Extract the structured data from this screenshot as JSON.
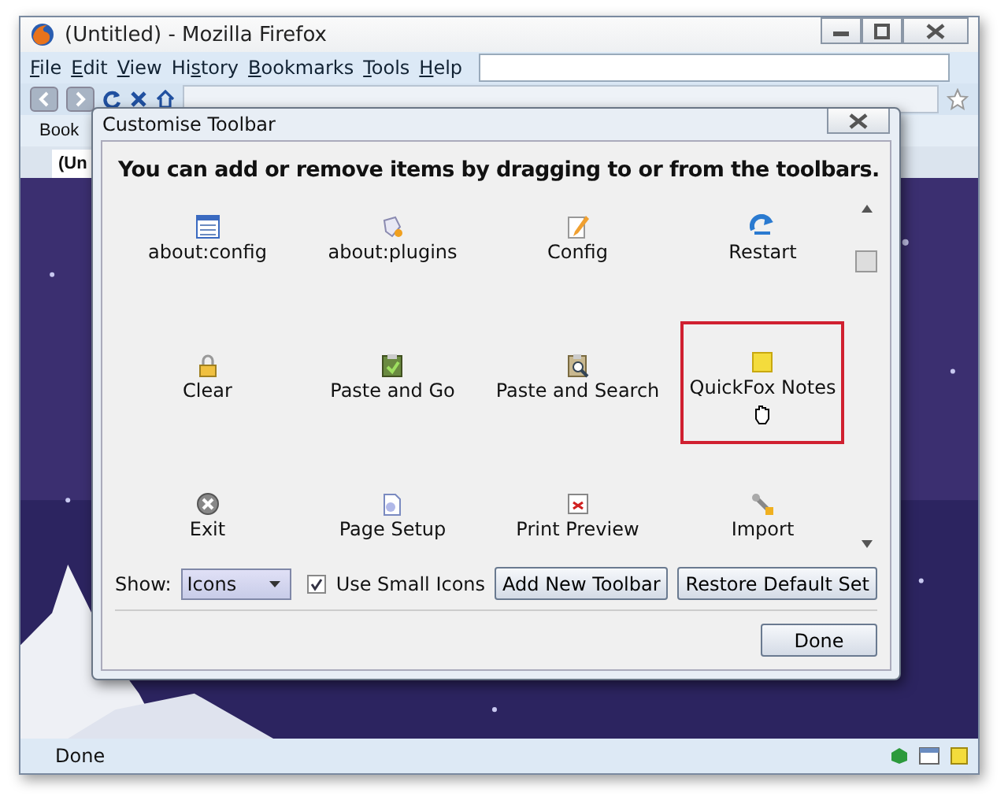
{
  "window": {
    "title": "(Untitled) - Mozilla Firefox"
  },
  "menu": [
    {
      "key": "F",
      "after": "ile"
    },
    {
      "key": "E",
      "after": "dit"
    },
    {
      "key": "V",
      "after": "iew"
    },
    {
      "before": "Hi",
      "key": "s",
      "after": "tory"
    },
    {
      "key": "B",
      "after": "ookmarks"
    },
    {
      "key": "T",
      "after": "ools"
    },
    {
      "key": "H",
      "after": "elp"
    }
  ],
  "bookmarks_bar": {
    "text": "Book"
  },
  "tab": {
    "title": "(Un"
  },
  "dialog": {
    "title": "Customise Toolbar",
    "heading": "You can add or remove items by dragging to or from the toolbars.",
    "items": [
      {
        "label": "about:config",
        "selected": false
      },
      {
        "label": "about:plugins",
        "selected": false
      },
      {
        "label": "Config",
        "selected": false
      },
      {
        "label": "Restart",
        "selected": false
      },
      {
        "label": "Clear",
        "selected": false
      },
      {
        "label": "Paste and Go",
        "selected": false
      },
      {
        "label": "Paste and Search",
        "selected": false
      },
      {
        "label": "QuickFox Notes",
        "selected": true
      },
      {
        "label": "Exit",
        "selected": false
      },
      {
        "label": "Page Setup",
        "selected": false
      },
      {
        "label": "Print Preview",
        "selected": false
      },
      {
        "label": "Import",
        "selected": false
      }
    ],
    "show_label": "Show:",
    "show_value": "Icons",
    "small_icons": {
      "label": "Use Small Icons",
      "checked": true
    },
    "buttons": [
      "Add New Toolbar",
      "Restore Default Set"
    ],
    "done": "Done"
  },
  "status_bar": {
    "text": "Done"
  }
}
